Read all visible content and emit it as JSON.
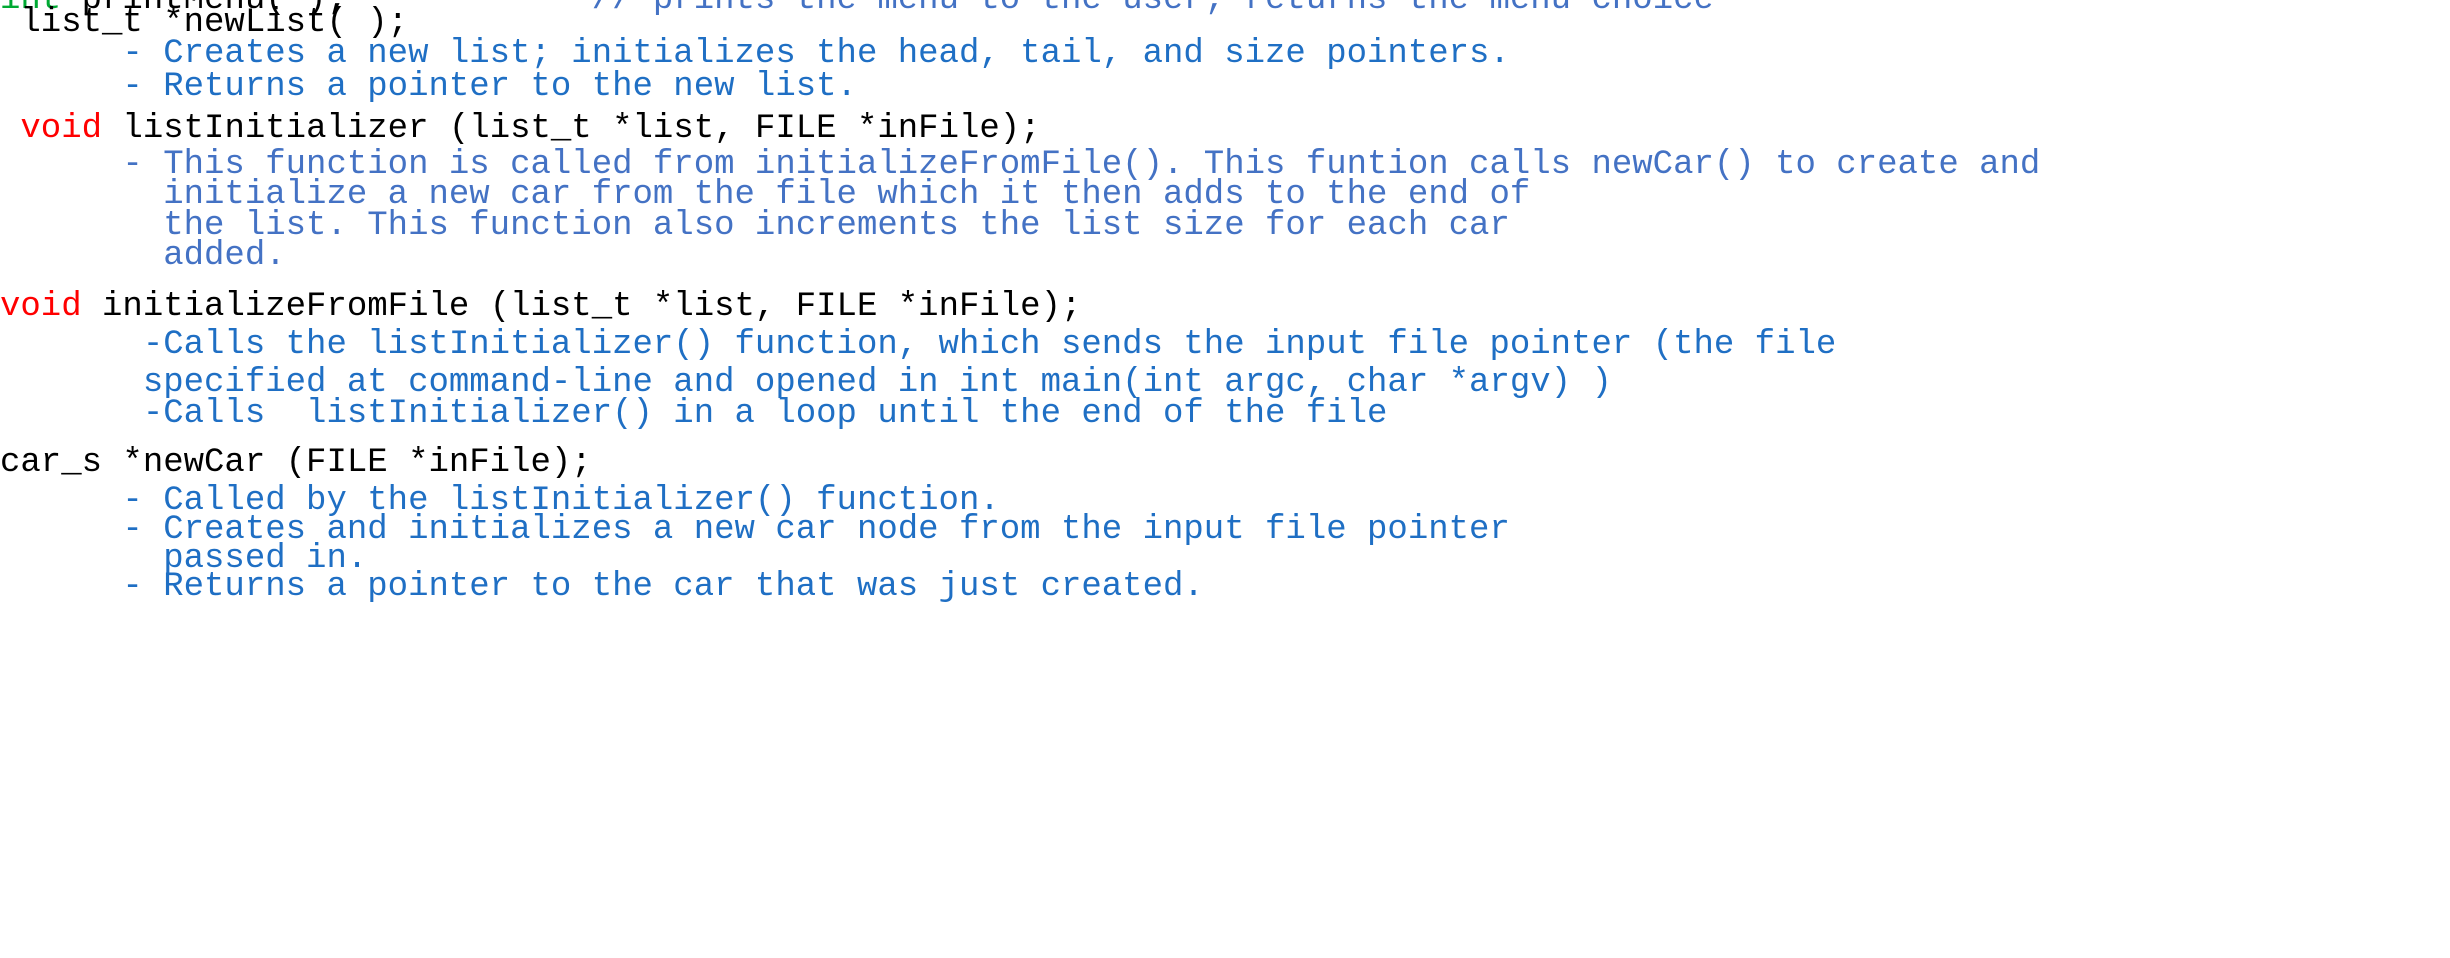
{
  "document": {
    "kind": "c-function-prototype-documentation",
    "background_color": "#FFFFFF",
    "colors": {
      "keyword_void": "#FF0000",
      "keyword_int": "#00A933",
      "signature_text": "#000000",
      "description_blue": "#1F6FC4",
      "description_blue_soft": "#4472C4",
      "comment_blue": "#4472C4"
    }
  },
  "lines": {
    "l00_kw": "int",
    "l00_sig": " printMenu( );",
    "l00_gap": "            ",
    "l00_comment": "// prints the menu to the user; returns the menu choice",
    "l01": " list_t *newList( );",
    "l02": "      - Creates a new list; initializes the head, tail, and size pointers.",
    "l03": "      - Returns a pointer to the new list.",
    "l04_kw": " void",
    "l04_sig": " listInitializer (list_t *list, FILE *inFile);",
    "l05": "      - This function is called from initializeFromFile(). This funtion calls newCar() to create and",
    "l06": "        initialize a new car from the file which it then adds to the end of",
    "l07": "        the list. This function also increments the list size for each car",
    "l08": "        added.",
    "l09_kw": "void",
    "l09_sig": " initializeFromFile (list_t *list, FILE *inFile);",
    "l10": "       -Calls the listInitializer() function, which sends the input file pointer (the file",
    "l11": "       specified at command-line and opened in int main(int argc, char *argv) )",
    "l12": "       -Calls  listInitializer() in a loop until the end of the file",
    "l13": "car_s *newCar (FILE *inFile);",
    "l14": "      - Called by the listInitializer() function.",
    "l15": "      - Creates and initializes a new car node from the input file pointer",
    "l16": "        passed in.",
    "l17": "      - Returns a pointer to the car that was just created."
  }
}
